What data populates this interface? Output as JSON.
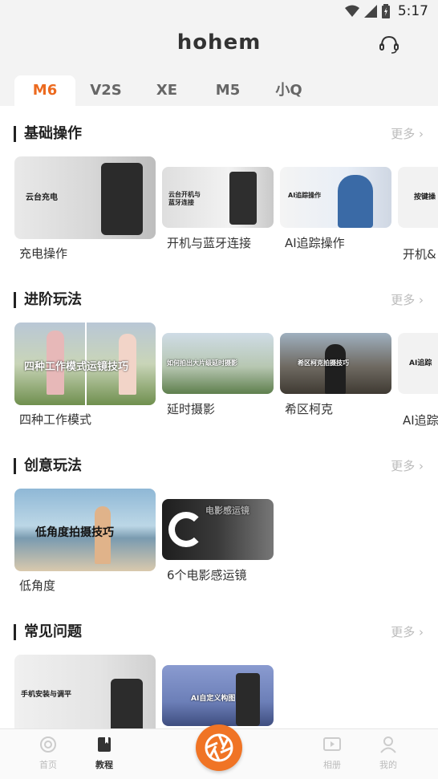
{
  "status": {
    "time": "5:17"
  },
  "header": {
    "logo": "hohem"
  },
  "tabs": [
    {
      "label": "M6",
      "active": true
    },
    {
      "label": "V2S",
      "active": false
    },
    {
      "label": "XE",
      "active": false
    },
    {
      "label": "M5",
      "active": false
    },
    {
      "label": "小Q",
      "active": false
    }
  ],
  "sections": [
    {
      "title": "基础操作",
      "more": "更多",
      "cards": [
        {
          "label": "充电操作",
          "thumb_text": "云台充电"
        },
        {
          "label": "开机与蓝牙连接",
          "thumb_text": "云台开机与蓝牙连接"
        },
        {
          "label": "AI追踪操作",
          "thumb_text": "AI追踪操作"
        },
        {
          "label": "开机&",
          "thumb_text": "按键操"
        }
      ]
    },
    {
      "title": "进阶玩法",
      "more": "更多",
      "cards": [
        {
          "label": "四种工作模式",
          "thumb_text": "四种工作模式运镜技巧"
        },
        {
          "label": "延时摄影",
          "thumb_text": "如何拍出大片级延时摄影"
        },
        {
          "label": "希区柯克",
          "thumb_text": "希区柯克拍摄技巧"
        },
        {
          "label": "AI追踪",
          "thumb_text": "AI追踪"
        }
      ]
    },
    {
      "title": "创意玩法",
      "more": "更多",
      "cards": [
        {
          "label": "低角度",
          "thumb_text": "低角度拍摄技巧"
        },
        {
          "label": "6个电影感运镜",
          "thumb_text": "电影感运镜"
        }
      ]
    },
    {
      "title": "常见问题",
      "more": "更多",
      "cards": [
        {
          "label": "",
          "thumb_text": "手机安装与调平"
        },
        {
          "label": "",
          "thumb_text": "AI自定义构图"
        }
      ]
    }
  ],
  "bottom_nav": [
    {
      "label": "首页",
      "icon": "home-icon",
      "active": false
    },
    {
      "label": "教程",
      "icon": "book-icon",
      "active": true
    },
    {
      "label": "",
      "icon": "shutter-icon",
      "active": false
    },
    {
      "label": "相册",
      "icon": "album-icon",
      "active": false
    },
    {
      "label": "我的",
      "icon": "profile-icon",
      "active": false
    }
  ],
  "colors": {
    "accent": "#ec6a1f",
    "nav_center": "#f07425"
  }
}
